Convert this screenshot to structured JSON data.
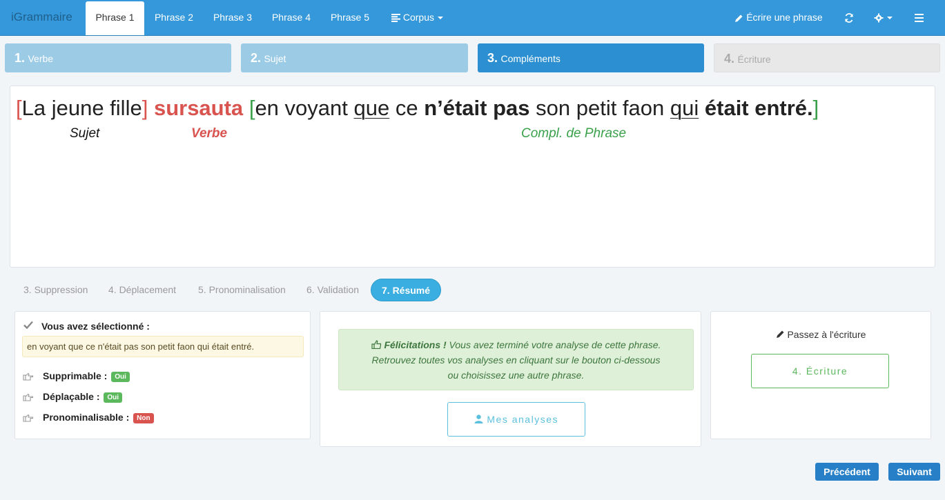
{
  "navbar": {
    "brand": "iGrammaire",
    "tabs": [
      {
        "label": "Phrase 1"
      },
      {
        "label": "Phrase 2"
      },
      {
        "label": "Phrase 3"
      },
      {
        "label": "Phrase 4"
      },
      {
        "label": "Phrase 5"
      }
    ],
    "corpus_label": "Corpus",
    "write_label": "Écrire une phrase"
  },
  "steps": [
    {
      "num": "1.",
      "label": "Verbe"
    },
    {
      "num": "2.",
      "label": "Sujet"
    },
    {
      "num": "3.",
      "label": "Compléments"
    },
    {
      "num": "4.",
      "label": "Écriture"
    }
  ],
  "sentence": {
    "open_subject": "[",
    "subject": "La jeune fille",
    "close_subject": "]",
    "verb": "sursauta",
    "open_compl": "[",
    "c1": "en voyant ",
    "c2": "que",
    "c3": " ce ",
    "c4": "n’était pas",
    "c5": " son petit faon ",
    "c6": "qui",
    "c7": " ",
    "c8": "était entré.",
    "close_compl": "]",
    "tags": {
      "subject": "Sujet",
      "verb": "Verbe",
      "compl": "Compl. de Phrase"
    }
  },
  "subtabs": [
    {
      "label": "3. Suppression"
    },
    {
      "label": "4. Déplacement"
    },
    {
      "label": "5. Pronominalisation"
    },
    {
      "label": "6. Validation"
    },
    {
      "label": "7. Résumé"
    }
  ],
  "selection": {
    "title": "Vous avez sélectionné :",
    "text": "en voyant que ce n'était pas son petit faon qui était entré.",
    "props": [
      {
        "label": "Supprimable :",
        "value": "Oui"
      },
      {
        "label": "Déplaçable :",
        "value": "Oui"
      },
      {
        "label": "Pronominalisable :",
        "value": "Non"
      }
    ]
  },
  "congrats": {
    "strong": "Félicitations !",
    "line1": " Vous avez terminé votre analyse de cette phrase.",
    "line2": "Retrouvez toutes vos analyses en cliquant sur le bouton ci-dessous",
    "line3": "ou choisissez une autre phrase.",
    "button": "Mes analyses"
  },
  "writing": {
    "title": "Passez à l'écriture",
    "button": "4. Écriture"
  },
  "footer": {
    "prev": "Précédent",
    "next": "Suivant"
  },
  "colors": {
    "navbar": "#3498db",
    "verb": "#d9534f",
    "complement": "#3aa14a",
    "accent": "#2b8fd1"
  }
}
